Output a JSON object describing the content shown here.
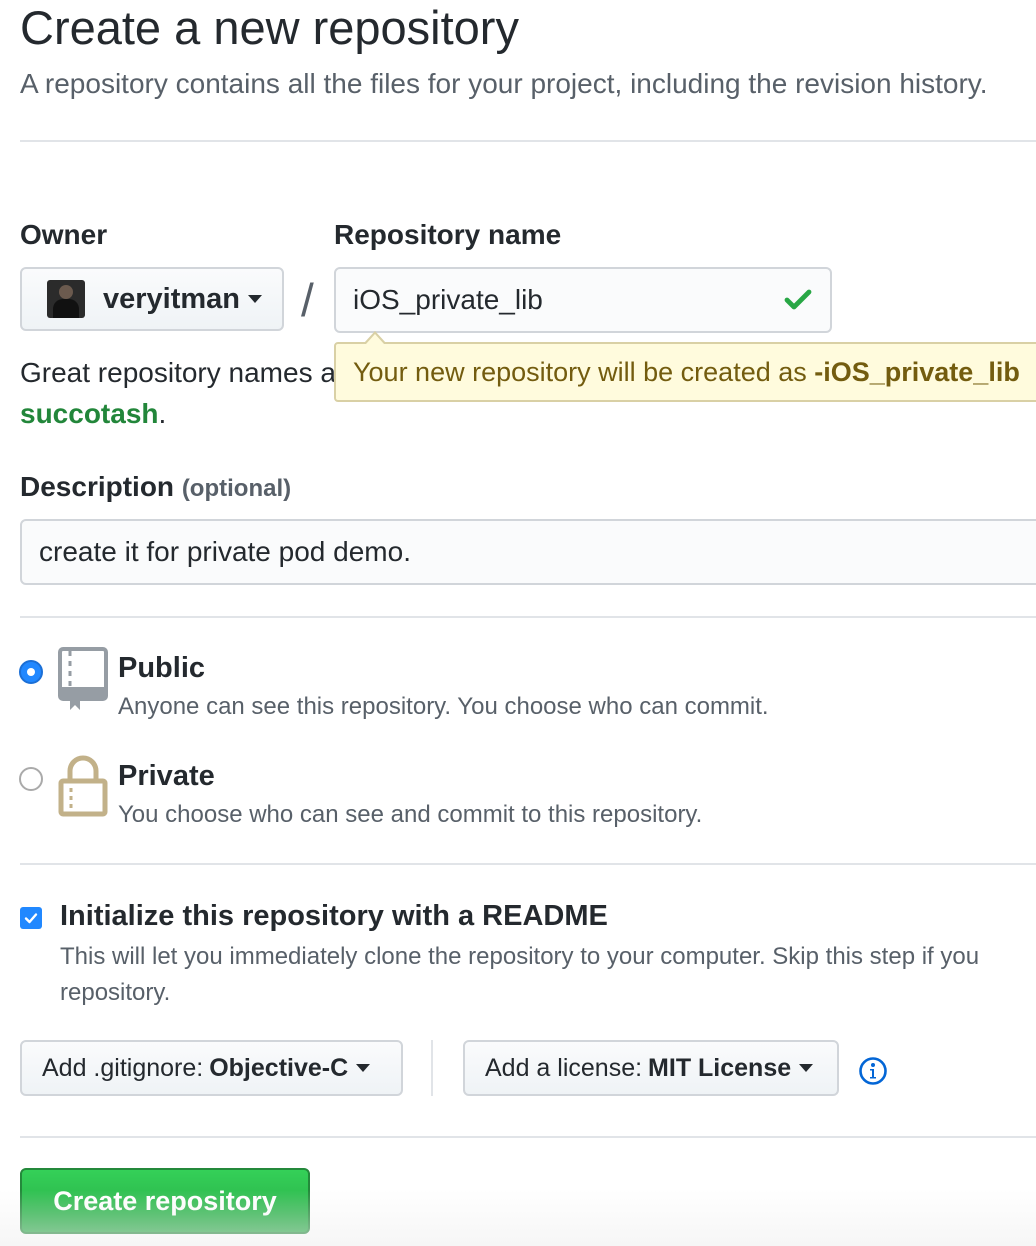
{
  "header": {
    "title": "Create a new repository",
    "subtitle": "A repository contains all the files for your project, including the revision history."
  },
  "owner": {
    "label": "Owner",
    "value": "veryitman"
  },
  "repo": {
    "label": "Repository name",
    "value": "iOS_private_lib"
  },
  "hint": {
    "text": "Great repository names a",
    "highlight": "succotash",
    "end": "."
  },
  "tooltip": {
    "prefix": "Your new repository will be created as ",
    "name": "-iOS_private_lib"
  },
  "description": {
    "label": "Description",
    "optional": "(optional)",
    "value": "create it for private pod demo."
  },
  "visibility": {
    "public": {
      "title": "Public",
      "desc": "Anyone can see this repository. You choose who can commit.",
      "selected": true
    },
    "private": {
      "title": "Private",
      "desc": "You choose who can see and commit to this repository.",
      "selected": false
    }
  },
  "readme": {
    "title": "Initialize this repository with a README",
    "desc_line1": "This will let you immediately clone the repository to your computer. Skip this step if you",
    "desc_line2": "repository.",
    "checked": true
  },
  "gitignore": {
    "label": "Add .gitignore:",
    "value": "Objective-C"
  },
  "license": {
    "label": "Add a license:",
    "value": "MIT License"
  },
  "submit": {
    "label": "Create repository"
  },
  "colors": {
    "primary": "#28a745",
    "link": "#2188ff",
    "tooltip_bg": "#fffbdd",
    "check_green": "#28a745"
  },
  "icons": [
    "chevron-down-icon",
    "checkmark-icon",
    "repo-icon",
    "lock-icon",
    "checkbox-icon",
    "info-icon"
  ]
}
